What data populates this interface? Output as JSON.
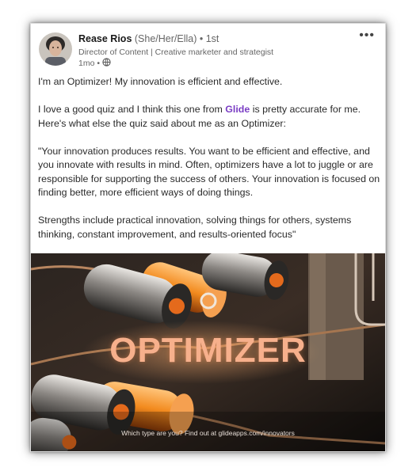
{
  "post": {
    "author_name": "Rease Rios",
    "author_pronouns": "(She/Her/Ella)",
    "connection_degree": "• 1st",
    "author_headline": "Director of Content | Creative marketer and strategist",
    "timestamp": "1mo •",
    "visibility_icon": "globe-icon",
    "more_icon": "more-horizontal-icon",
    "more_glyph": "•••",
    "paragraph1": "I'm an Optimizer! My innovation is efficient and effective.",
    "paragraph2_before": "I love a good quiz and I think this one from ",
    "paragraph2_link": "Glide",
    "paragraph2_after": " is pretty accurate for me. Here's what else the quiz said about me as an Optimizer:",
    "paragraph3": "\"Your innovation produces results. You want to be efficient and effective, and you innovate with results in mind. Often, optimizers have a lot to juggle or are responsible for supporting the success of others. Your innovation is focused on finding better, more efficient ways of doing things.",
    "paragraph4": "Strengths include practical innovation, solving things for others, systems thinking, constant improvement, and results-oriented focus\""
  },
  "media": {
    "title": "OPTIMIZER",
    "caption": "Which type are you? Find out at glideapps.com/innovators"
  },
  "colors": {
    "link": "#7a3dc4",
    "title_accent": "#f7b08c",
    "orange_accent": "#f28a1e"
  }
}
